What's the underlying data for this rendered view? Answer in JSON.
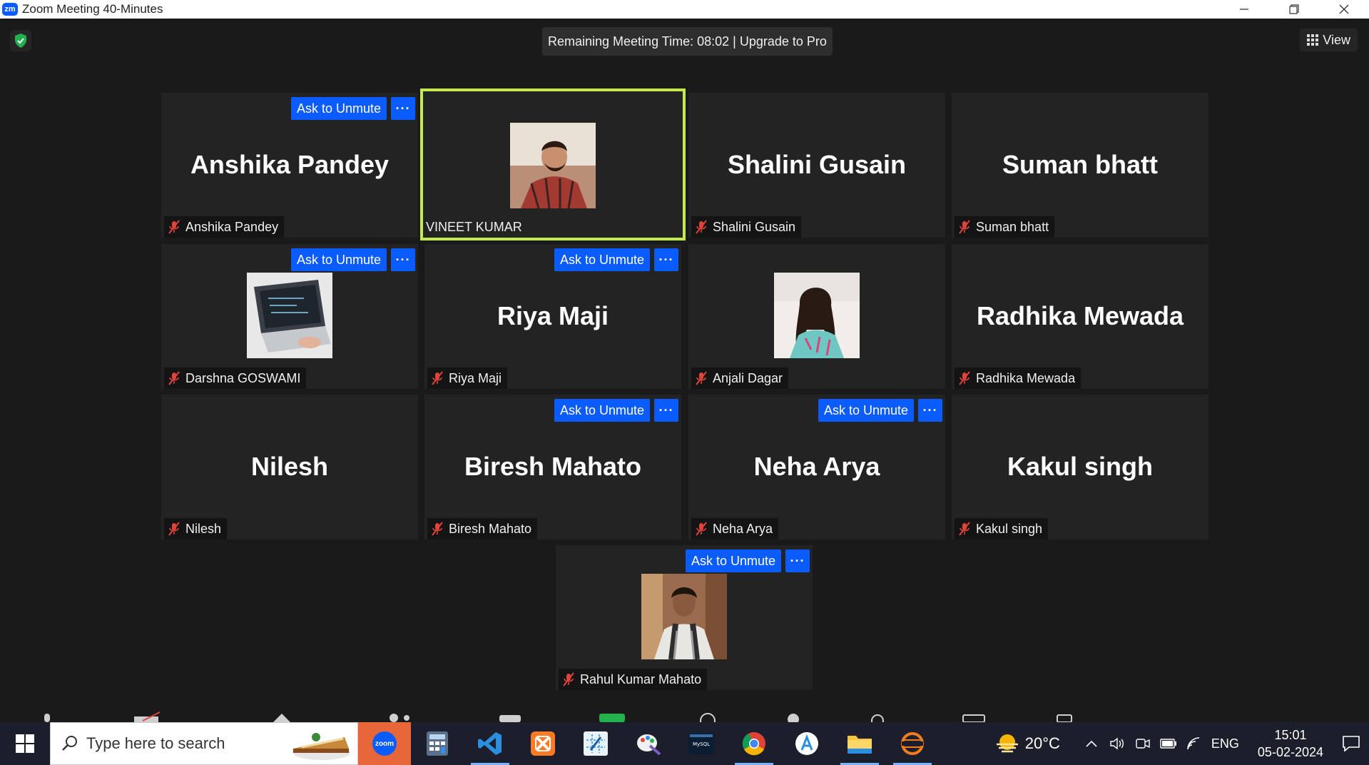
{
  "window": {
    "title": "Zoom Meeting 40-Minutes",
    "app_logo": "zm",
    "controls": [
      "minimize-icon",
      "restore-icon",
      "close-icon"
    ]
  },
  "header": {
    "timer_text": "Remaining Meeting Time: 08:02 | Upgrade to Pro",
    "view_label": "View",
    "security_icon": "shield-check-icon"
  },
  "colors": {
    "accent": "#0b5cff",
    "active_speaker": "#c5e84a",
    "muted_mic": "#e0433a",
    "tile_bg": "#232323"
  },
  "buttons": {
    "ask_to_unmute": "Ask to Unmute",
    "more": "···"
  },
  "participants": [
    {
      "display_name": "Anshika Pandey",
      "label": "Anshika Pandey",
      "muted": true,
      "has_video": false,
      "ask_unmute": true
    },
    {
      "display_name": "",
      "label": "VINEET KUMAR",
      "muted": false,
      "has_video": true,
      "active_speaker": true,
      "ask_unmute": false
    },
    {
      "display_name": "Shalini Gusain",
      "label": "Shalini Gusain",
      "muted": true,
      "has_video": false,
      "ask_unmute": false
    },
    {
      "display_name": "Suman bhatt",
      "label": "Suman bhatt",
      "muted": true,
      "has_video": false,
      "ask_unmute": false
    },
    {
      "display_name": "",
      "label": "Darshna GOSWAMI",
      "muted": true,
      "has_video": true,
      "ask_unmute": true
    },
    {
      "display_name": "Riya Maji",
      "label": "Riya Maji",
      "muted": true,
      "has_video": false,
      "ask_unmute": true
    },
    {
      "display_name": "",
      "label": "Anjali Dagar",
      "muted": true,
      "has_video": true,
      "ask_unmute": false
    },
    {
      "display_name": "Radhika Mewada",
      "label": "Radhika Mewada",
      "muted": true,
      "has_video": false,
      "ask_unmute": false
    },
    {
      "display_name": "Nilesh",
      "label": "Nilesh",
      "muted": true,
      "has_video": false,
      "ask_unmute": false
    },
    {
      "display_name": "Biresh Mahato",
      "label": "Biresh Mahato",
      "muted": true,
      "has_video": false,
      "ask_unmute": true
    },
    {
      "display_name": "Neha Arya",
      "label": "Neha Arya",
      "muted": true,
      "has_video": false,
      "ask_unmute": true
    },
    {
      "display_name": "Kakul singh",
      "label": "Kakul singh",
      "muted": true,
      "has_video": false,
      "ask_unmute": false
    },
    {
      "display_name": "",
      "label": "Rahul Kumar Mahato",
      "muted": true,
      "has_video": true,
      "ask_unmute": true
    }
  ],
  "taskbar": {
    "search_placeholder": "Type here to search",
    "apps": [
      "zoom-icon",
      "calculator-icon",
      "vscode-icon",
      "xampp-icon",
      "snipping-tool-icon",
      "paint-icon",
      "mysql-icon",
      "chrome-icon",
      "app-store-icon",
      "file-explorer-icon",
      "eclipse-icon"
    ],
    "weather": "20°C",
    "language": "ENG",
    "time": "15:01",
    "date": "05-02-2024"
  }
}
